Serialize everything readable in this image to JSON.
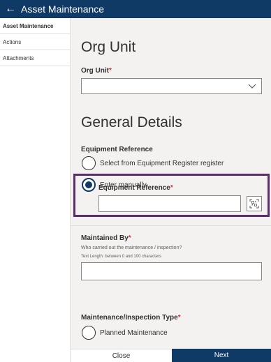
{
  "header": {
    "back_icon": "arrow-left-icon",
    "title": "Asset Maintenance"
  },
  "sidebar": {
    "items": [
      {
        "label": "Asset Maintenance",
        "active": true
      },
      {
        "label": "Actions",
        "active": false
      },
      {
        "label": "Attachments",
        "active": false
      }
    ]
  },
  "org_unit_section": {
    "heading": "Org Unit",
    "field_label": "Org Unit",
    "required_mark": "*",
    "value": ""
  },
  "general_section": {
    "heading": "General Details",
    "equipment_reference_label": "Equipment Reference",
    "options": [
      {
        "label": "Select from Equipment Register register",
        "selected": false
      },
      {
        "label": "Enter manually",
        "selected": true
      }
    ],
    "manual_field_label": "Equipment Reference",
    "manual_required_mark": "*",
    "manual_value": "",
    "scan_icon": "barcode-scan-icon"
  },
  "maintained_by": {
    "label": "Maintained By",
    "required_mark": "*",
    "help": "Who carried out the maintenance / inspection?",
    "length_hint": "Text Length: between 0 and 100 characters",
    "value": ""
  },
  "maintenance_type": {
    "label": "Maintenance/Inspection Type",
    "required_mark": "*",
    "options": [
      {
        "label": "Planned Maintenance",
        "selected": false
      }
    ]
  },
  "footer": {
    "close_label": "Close",
    "next_label": "Next"
  },
  "colors": {
    "header_bg": "#0f3a66",
    "highlight_border": "#5c2d6e",
    "required": "#d13438"
  }
}
